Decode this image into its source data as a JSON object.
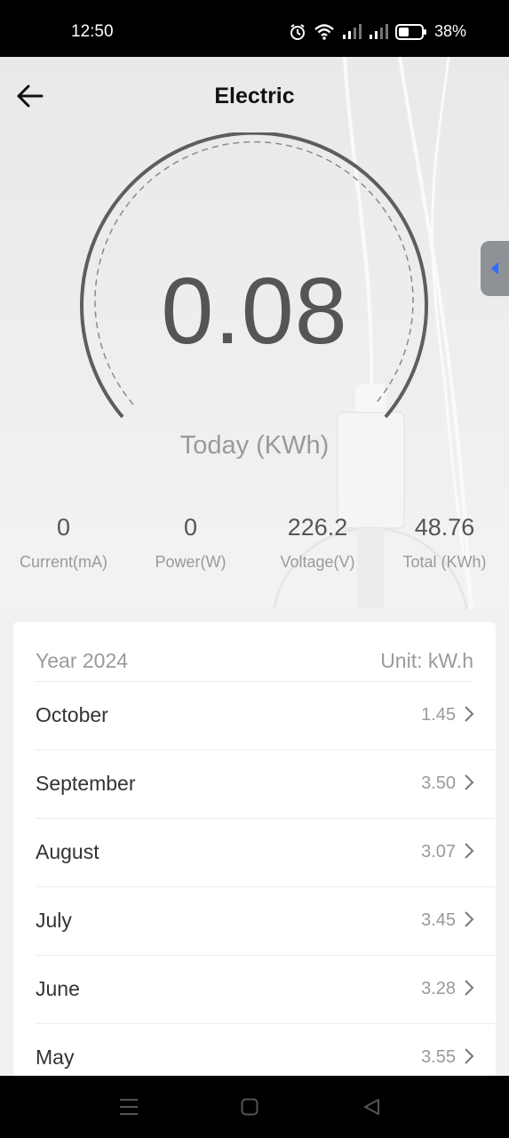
{
  "status": {
    "time": "12:50",
    "battery": "38%"
  },
  "header": {
    "title": "Electric"
  },
  "gauge": {
    "value": "0.08",
    "label": "Today (KWh)"
  },
  "stats": [
    {
      "value": "0",
      "label": "Current(mA)"
    },
    {
      "value": "0",
      "label": "Power(W)"
    },
    {
      "value": "226.2",
      "label": "Voltage(V)"
    },
    {
      "value": "48.76",
      "label": "Total (KWh)"
    }
  ],
  "list": {
    "year": "Year 2024",
    "unit": "Unit: kW.h",
    "rows": [
      {
        "month": "October",
        "value": "1.45"
      },
      {
        "month": "September",
        "value": "3.50"
      },
      {
        "month": "August",
        "value": "3.07"
      },
      {
        "month": "July",
        "value": "3.45"
      },
      {
        "month": "June",
        "value": "3.28"
      },
      {
        "month": "May",
        "value": "3.55"
      }
    ]
  },
  "colors": {
    "accent": "#2f6bff",
    "text_primary": "#555555",
    "text_secondary": "#9a9a9a"
  },
  "icons": {
    "back": "arrow-left-icon",
    "chevron": "chevron-right-icon",
    "alarm": "alarm-icon",
    "wifi": "wifi-icon",
    "signal": "signal-icon",
    "battery": "battery-icon"
  }
}
